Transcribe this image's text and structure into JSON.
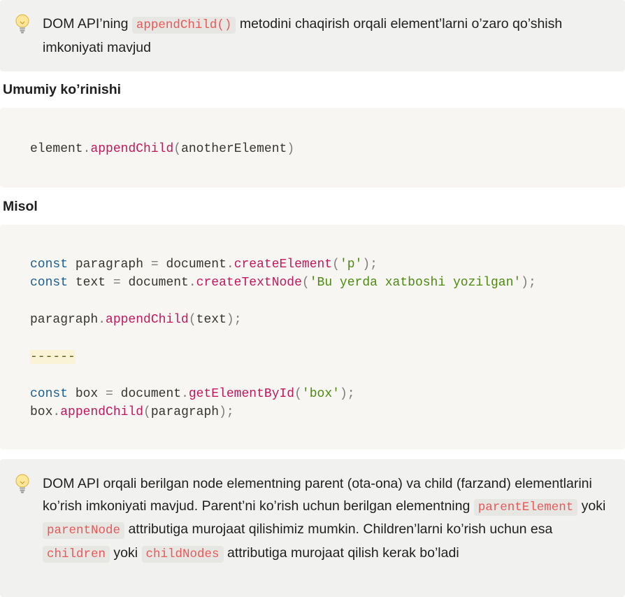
{
  "callout1": {
    "text_before": "DOM API’ning ",
    "code": "appendChild()",
    "text_after": " metodini chaqirish orqali element’larni o’zaro qo’shish imkoniyati mavjud"
  },
  "heading_general": "Umumiy ko’rinishi",
  "code_general": {
    "obj": "element",
    "dot": ".",
    "method": "appendChild",
    "open": "(",
    "arg": "anotherElement",
    "close": ")"
  },
  "heading_example": "Misol",
  "code_example": {
    "l1_kw": "const",
    "l1_var": " paragraph ",
    "l1_eq": "=",
    "l1_obj": " document",
    "l1_dot": ".",
    "l1_fn": "createElement",
    "l1_open": "(",
    "l1_str": "'p'",
    "l1_close": ");",
    "l2_kw": "const",
    "l2_var": " text ",
    "l2_eq": "=",
    "l2_obj": " document",
    "l2_dot": ".",
    "l2_fn": "createTextNode",
    "l2_open": "(",
    "l2_str": "'Bu yerda xatboshi yozilgan'",
    "l2_close": ");",
    "l3_obj": "paragraph",
    "l3_dot": ".",
    "l3_fn": "appendChild",
    "l3_open": "(",
    "l3_arg": "text",
    "l3_close": ");",
    "separator": "------",
    "l4_kw": "const",
    "l4_var": " box ",
    "l4_eq": "=",
    "l4_obj": " document",
    "l4_dot": ".",
    "l4_fn": "getElementById",
    "l4_open": "(",
    "l4_str": "'box'",
    "l4_close": ");",
    "l5_obj": "box",
    "l5_dot": ".",
    "l5_fn": "appendChild",
    "l5_open": "(",
    "l5_arg": "paragraph",
    "l5_close": ");"
  },
  "callout2": {
    "t1": "DOM API orqali berilgan node elementning parent (ota-ona) va child (farzand) elementlarini ko’rish imkoniyati mavjud. Parent’ni ko’rish uchun berilgan elementning ",
    "c1": "parentElement",
    "t2": " yoki ",
    "c2": "parentNode",
    "t3": " attributiga murojaat qilishimiz mumkin. Children’larni ko’rish uchun esa ",
    "c3": "children",
    "t4": " yoki ",
    "c4": "childNodes",
    "t5": " attributiga murojaat qilish kerak bo’ladi"
  },
  "icons": {
    "callout": "lightbulb-icon"
  },
  "colors": {
    "inline_code": "#eb5757",
    "keyword": "#1c5f8f",
    "function": "#c2185b",
    "string": "#4c8a10",
    "callout_bg": "#f1f1ef",
    "code_bg": "#f7f6f3"
  }
}
